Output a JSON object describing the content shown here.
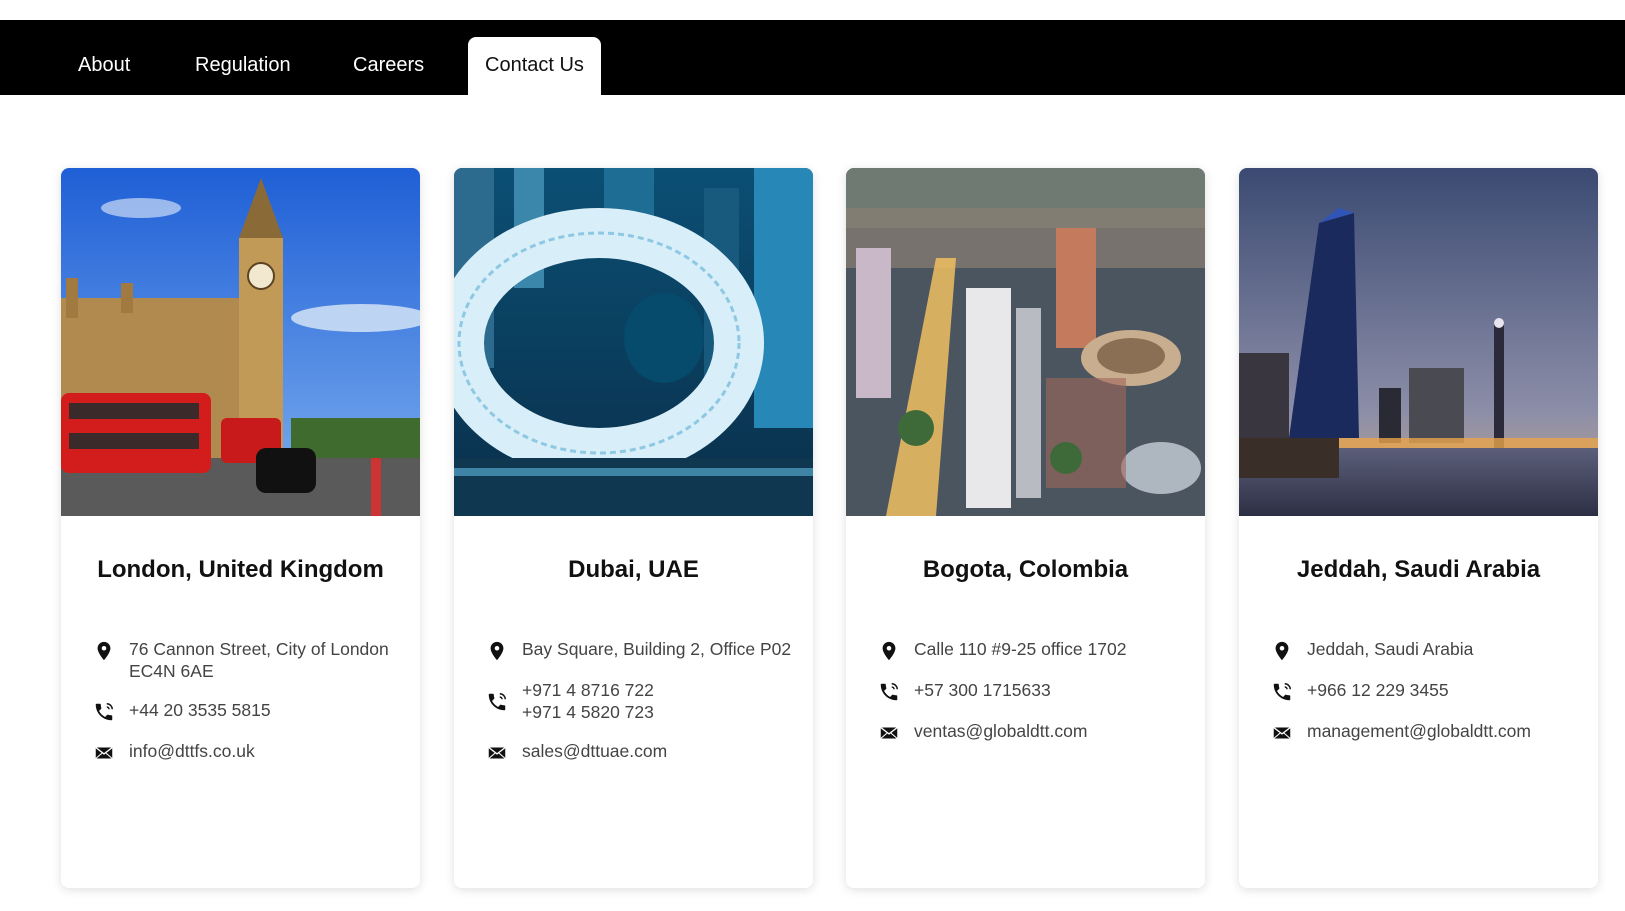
{
  "nav": {
    "tabs": [
      {
        "label": "About"
      },
      {
        "label": "Regulation"
      },
      {
        "label": "Careers"
      },
      {
        "label": "Contact Us",
        "active": true
      }
    ]
  },
  "offices": [
    {
      "city": "London, United Kingdom",
      "address": [
        "76 Cannon Street, City of London",
        "EC4N 6AE"
      ],
      "phones": [
        "+44 20 3535 5815"
      ],
      "email": "info@dttfs.co.uk",
      "photo": "big-ben-westminster-red-buses"
    },
    {
      "city": "Dubai, UAE",
      "address": [
        "Bay Square, Building 2, Office P02"
      ],
      "phones": [
        "+971 4 8716 722",
        "+971 4 5820 723"
      ],
      "email": "sales@dttuae.com",
      "photo": "museum-of-the-future-dubai"
    },
    {
      "city": "Bogota, Colombia",
      "address": [
        "Calle 110 #9-25 office 1702"
      ],
      "phones": [
        "+57 300 1715633"
      ],
      "email": "ventas@globaldtt.com",
      "photo": "bogota-aerial-night"
    },
    {
      "city": "Jeddah, Saudi Arabia",
      "address": [
        "Jeddah, Saudi Arabia"
      ],
      "phones": [
        "+966 12 229 3455"
      ],
      "email": "management@globaldtt.com",
      "photo": "jeddah-waterfront-dusk"
    }
  ],
  "colors": {
    "nav_bg": "#000000",
    "text": "#111111",
    "muted": "#444444"
  }
}
